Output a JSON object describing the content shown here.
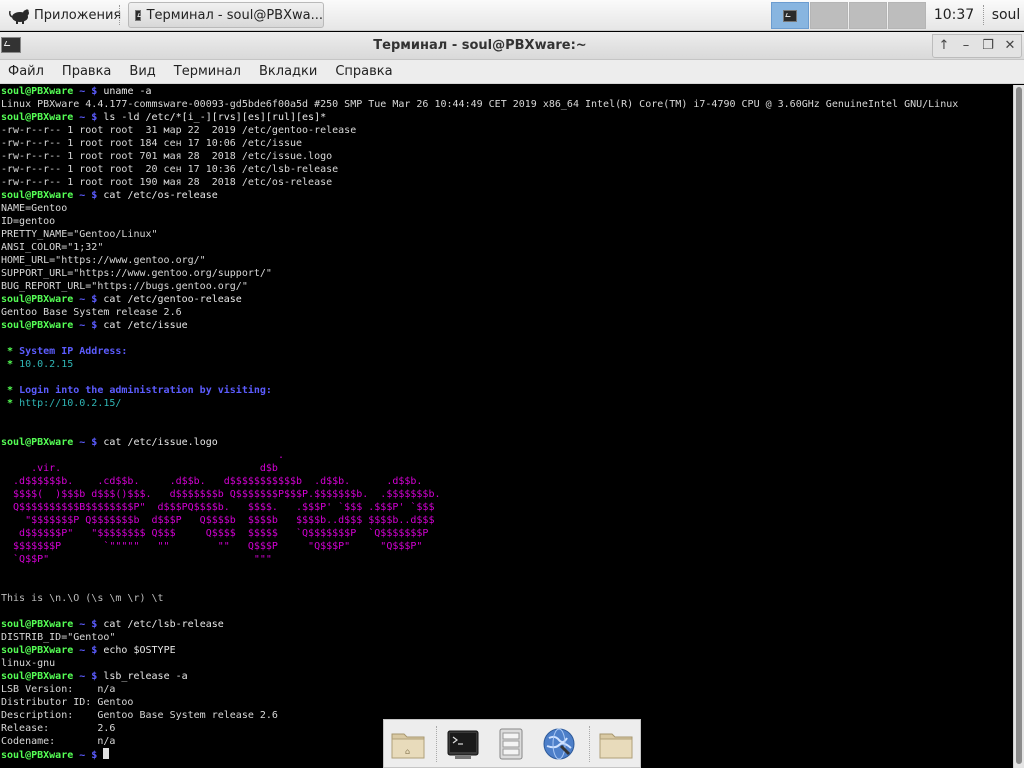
{
  "panel": {
    "apps_label": "Приложения",
    "task_label": "Терминал - soul@PBXwa...",
    "clock": "10:37",
    "user": "soul",
    "workspaces": 4,
    "active_workspace": 1
  },
  "window": {
    "title": "Терминал - soul@PBXware:~",
    "buttons": [
      "↑",
      "–",
      "❐",
      "✕"
    ]
  },
  "menubar": [
    "Файл",
    "Правка",
    "Вид",
    "Терминал",
    "Вкладки",
    "Справка"
  ],
  "terminal": {
    "prompt_user": "soul@PBXware",
    "prompt_path": "~",
    "prompt_sign": "$",
    "lines": [
      {
        "t": "cmd",
        "v": "uname -a"
      },
      {
        "t": "out",
        "v": "Linux PBXware 4.4.177-commsware-00093-gd5bde6f00a5d #250 SMP Tue Mar 26 10:44:49 CET 2019 x86_64 Intel(R) Core(TM) i7-4790 CPU @ 3.60GHz GenuineIntel GNU/Linux"
      },
      {
        "t": "cmd",
        "v": "ls -ld /etc/*[i_-][rvs][es][rul][es]*"
      },
      {
        "t": "out",
        "v": "-rw-r--r-- 1 root root  31 мар 22  2019 /etc/gentoo-release"
      },
      {
        "t": "out",
        "v": "-rw-r--r-- 1 root root 184 сен 17 10:06 /etc/issue"
      },
      {
        "t": "out",
        "v": "-rw-r--r-- 1 root root 701 мая 28  2018 /etc/issue.logo"
      },
      {
        "t": "out",
        "v": "-rw-r--r-- 1 root root  20 сен 17 10:36 /etc/lsb-release"
      },
      {
        "t": "out",
        "v": "-rw-r--r-- 1 root root 190 мая 28  2018 /etc/os-release"
      },
      {
        "t": "cmd",
        "v": "cat /etc/os-release"
      },
      {
        "t": "out",
        "v": "NAME=Gentoo"
      },
      {
        "t": "out",
        "v": "ID=gentoo"
      },
      {
        "t": "out",
        "v": "PRETTY_NAME=\"Gentoo/Linux\""
      },
      {
        "t": "out",
        "v": "ANSI_COLOR=\"1;32\""
      },
      {
        "t": "out",
        "v": "HOME_URL=\"https://www.gentoo.org/\""
      },
      {
        "t": "out",
        "v": "SUPPORT_URL=\"https://www.gentoo.org/support/\""
      },
      {
        "t": "out",
        "v": "BUG_REPORT_URL=\"https://bugs.gentoo.org/\""
      },
      {
        "t": "cmd",
        "v": "cat /etc/gentoo-release"
      },
      {
        "t": "out",
        "v": "Gentoo Base System release 2.6"
      },
      {
        "t": "cmd",
        "v": "cat /etc/issue"
      },
      {
        "t": "out",
        "v": ""
      },
      {
        "t": "star",
        "k": "hdr",
        "v": "System IP Address:"
      },
      {
        "t": "star",
        "k": "val",
        "v": "10.0.2.15"
      },
      {
        "t": "out",
        "v": ""
      },
      {
        "t": "star",
        "k": "hdr",
        "v": "Login into the administration by visiting:"
      },
      {
        "t": "star",
        "k": "val",
        "v": "http://10.0.2.15/"
      },
      {
        "t": "out",
        "v": ""
      },
      {
        "t": "out",
        "v": ""
      },
      {
        "t": "cmd",
        "v": "cat /etc/issue.logo"
      },
      {
        "t": "logo",
        "v": "                                              ."
      },
      {
        "t": "logo",
        "v": "     .vir.                                 d$b"
      },
      {
        "t": "logo",
        "v": "  .d$$$$$$b.    .cd$$b.     .d$$b.   d$$$$$$$$$$$b  .d$$b.      .d$$b."
      },
      {
        "t": "logo",
        "v": "  $$$$(  )$$$b d$$$()$$$.   d$$$$$$$b Q$$$$$$$P$$$P.$$$$$$$b.  .$$$$$$$b."
      },
      {
        "t": "logo",
        "v": "  Q$$$$$$$$$$B$$$$$$$$P\"  d$$$PQ$$$$b.   $$$$.   .$$$P' `$$$ .$$$P' `$$$"
      },
      {
        "t": "logo",
        "v": "    \"$$$$$$$P Q$$$$$$$b  d$$$P   Q$$$$b  $$$$b   $$$$b..d$$$ $$$$b..d$$$"
      },
      {
        "t": "logo",
        "v": "   d$$$$$$P\"   \"$$$$$$$$ Q$$$     Q$$$$  $$$$$   `Q$$$$$$$P  `Q$$$$$$$P"
      },
      {
        "t": "logo",
        "v": "  $$$$$$$P       `\"\"\"\"\"   \"\"        \"\"   Q$$$P     \"Q$$$P\"     \"Q$$$P\""
      },
      {
        "t": "logo",
        "v": "  `Q$$P\"                                  \"\"\""
      },
      {
        "t": "out",
        "v": ""
      },
      {
        "t": "out",
        "v": ""
      },
      {
        "t": "dim",
        "v": "This is \\n.\\O (\\s \\m \\r) \\t"
      },
      {
        "t": "out",
        "v": ""
      },
      {
        "t": "cmd",
        "v": "cat /etc/lsb-release"
      },
      {
        "t": "out",
        "v": "DISTRIB_ID=\"Gentoo\""
      },
      {
        "t": "cmd",
        "v": "echo $OSTYPE"
      },
      {
        "t": "out",
        "v": "linux-gnu"
      },
      {
        "t": "cmd",
        "v": "lsb_release -a"
      },
      {
        "t": "out",
        "v": "LSB Version:    n/a"
      },
      {
        "t": "out",
        "v": "Distributor ID: Gentoo"
      },
      {
        "t": "out",
        "v": "Description:    Gentoo Base System release 2.6"
      },
      {
        "t": "out",
        "v": "Release:        2.6"
      },
      {
        "t": "out",
        "v": "Codename:       n/a"
      },
      {
        "t": "prompt",
        "v": ""
      }
    ]
  },
  "dock": {
    "items": [
      "home-folder-icon",
      "terminal-icon",
      "file-manager-icon",
      "web-browser-icon",
      "folder-icon"
    ]
  },
  "colors": {
    "prompt_user": "#55ff55",
    "prompt_path": "#5c5cff",
    "logo": "#d500d5",
    "ip_value": "#2fb5b5",
    "workspace_active": "#88b5e0"
  }
}
